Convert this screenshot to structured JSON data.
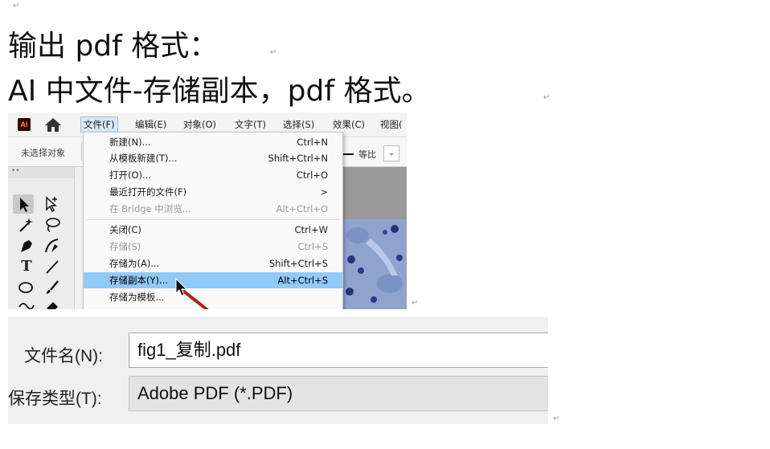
{
  "doc": {
    "line1": "输出 pdf 格式：",
    "line2": "AI 中文件-存储副本，pdf 格式。"
  },
  "ai": {
    "logo": "Ai",
    "menu": [
      "文件(F)",
      "编辑(E)",
      "对象(O)",
      "文字(T)",
      "选择(S)",
      "效果(C)",
      "视图("
    ],
    "control_bar": {
      "no_selection": "未选择对象",
      "ratio": "等比"
    },
    "file_menu": [
      {
        "label": "新建(N)...",
        "shortcut": "Ctrl+N"
      },
      {
        "label": "从模板新建(T)...",
        "shortcut": "Shift+Ctrl+N"
      },
      {
        "label": "打开(O)...",
        "shortcut": "Ctrl+O"
      },
      {
        "label": "最近打开的文件(F)",
        "shortcut": ">"
      },
      {
        "label": "在 Bridge 中浏览...",
        "shortcut": "Alt+Ctrl+O",
        "disabled": true
      },
      {
        "label": "关闭(C)",
        "shortcut": "Ctrl+W"
      },
      {
        "label": "存储(S)",
        "shortcut": "Ctrl+S",
        "disabled": true
      },
      {
        "label": "存储为(A)...",
        "shortcut": "Shift+Ctrl+S"
      },
      {
        "label": "存储副本(Y)...",
        "shortcut": "Alt+Ctrl+S",
        "highlighted": true
      },
      {
        "label": "存储为模板...",
        "shortcut": ""
      }
    ]
  },
  "dialog": {
    "filename_label": "文件名(N):",
    "filename_value": "fig1_复制.pdf",
    "filetype_label": "保存类型(T):",
    "filetype_value": "Adobe PDF (*.PDF)"
  },
  "colors": {
    "menu_highlight": "#91c9f7",
    "ai_logo_bg": "#330000",
    "ai_logo_text": "#ff9a00",
    "cursor_arrow": "#b02810"
  }
}
